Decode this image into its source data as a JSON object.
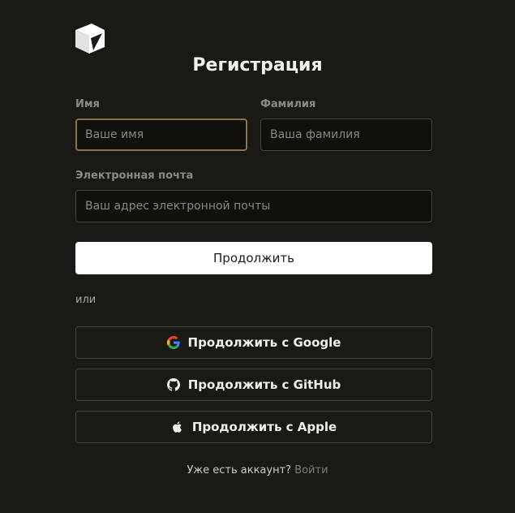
{
  "form": {
    "title": "Регистрация",
    "first_name_label": "Имя",
    "first_name_placeholder": "Ваше имя",
    "last_name_label": "Фамилия",
    "last_name_placeholder": "Ваша фамилия",
    "email_label": "Электронная почта",
    "email_placeholder": "Ваш адрес электронной почты",
    "continue_label": "Продолжить"
  },
  "divider": {
    "or_label": "или"
  },
  "oauth": {
    "google_label": "Продолжить с Google",
    "github_label": "Продолжить с GitHub",
    "apple_label": "Продолжить с Apple"
  },
  "footer": {
    "prompt": "Уже есть аккаунт?",
    "login_link": "Войти"
  },
  "icons": {
    "logo": "cube-logo-icon",
    "google": "google-icon",
    "github": "github-icon",
    "apple": "apple-icon"
  },
  "colors": {
    "background": "#1b1916",
    "input_background": "#12100d",
    "focus_border": "#8a7444",
    "primary_button": "#ffffff"
  }
}
